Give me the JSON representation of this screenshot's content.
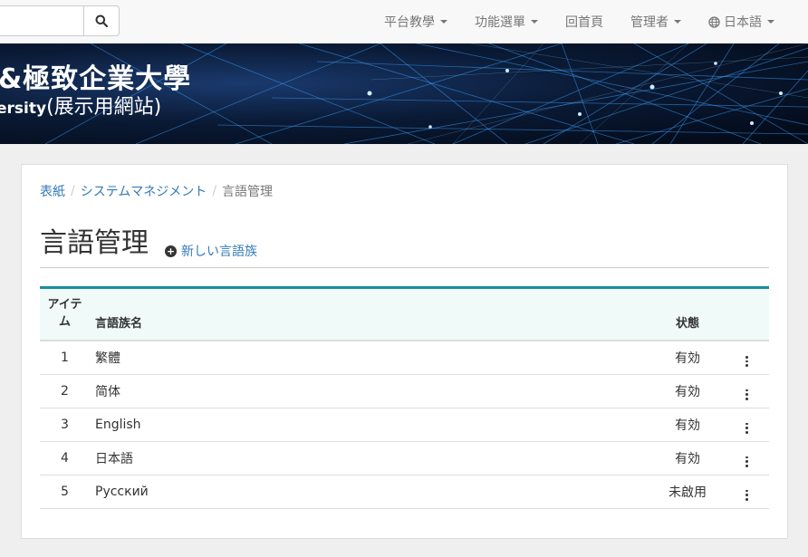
{
  "topnav": {
    "search": {
      "value": "",
      "placeholder": ""
    },
    "items": [
      {
        "label": "平台教學",
        "has_caret": true
      },
      {
        "label": "功能選單",
        "has_caret": true
      },
      {
        "label": "回首頁",
        "has_caret": false
      },
      {
        "label": "管理者",
        "has_caret": true
      },
      {
        "label": "日本語",
        "has_caret": true,
        "icon": "globe-icon"
      }
    ]
  },
  "banner": {
    "title": "&極致企業大學",
    "subtitle_latin": "ersity",
    "subtitle_cjk": "(展示用網站)"
  },
  "breadcrumb": {
    "items": [
      "表紙",
      "システムマネジメント"
    ],
    "current": "言語管理"
  },
  "page": {
    "title": "言語管理",
    "new_link": "新しい言語族"
  },
  "table": {
    "headers": {
      "idx": "アイテム",
      "name": "言語族名",
      "status": "状態"
    },
    "rows": [
      {
        "idx": "1",
        "name": "繁體",
        "status": "有効"
      },
      {
        "idx": "2",
        "name": "简体",
        "status": "有効"
      },
      {
        "idx": "3",
        "name": "English",
        "status": "有効"
      },
      {
        "idx": "4",
        "name": "日本語",
        "status": "有効"
      },
      {
        "idx": "5",
        "name": "Русский",
        "status": "未啟用"
      }
    ]
  },
  "colors": {
    "link": "#337ab7",
    "table_accent": "#1a8d9e",
    "header_bg": "#f0faf8"
  }
}
